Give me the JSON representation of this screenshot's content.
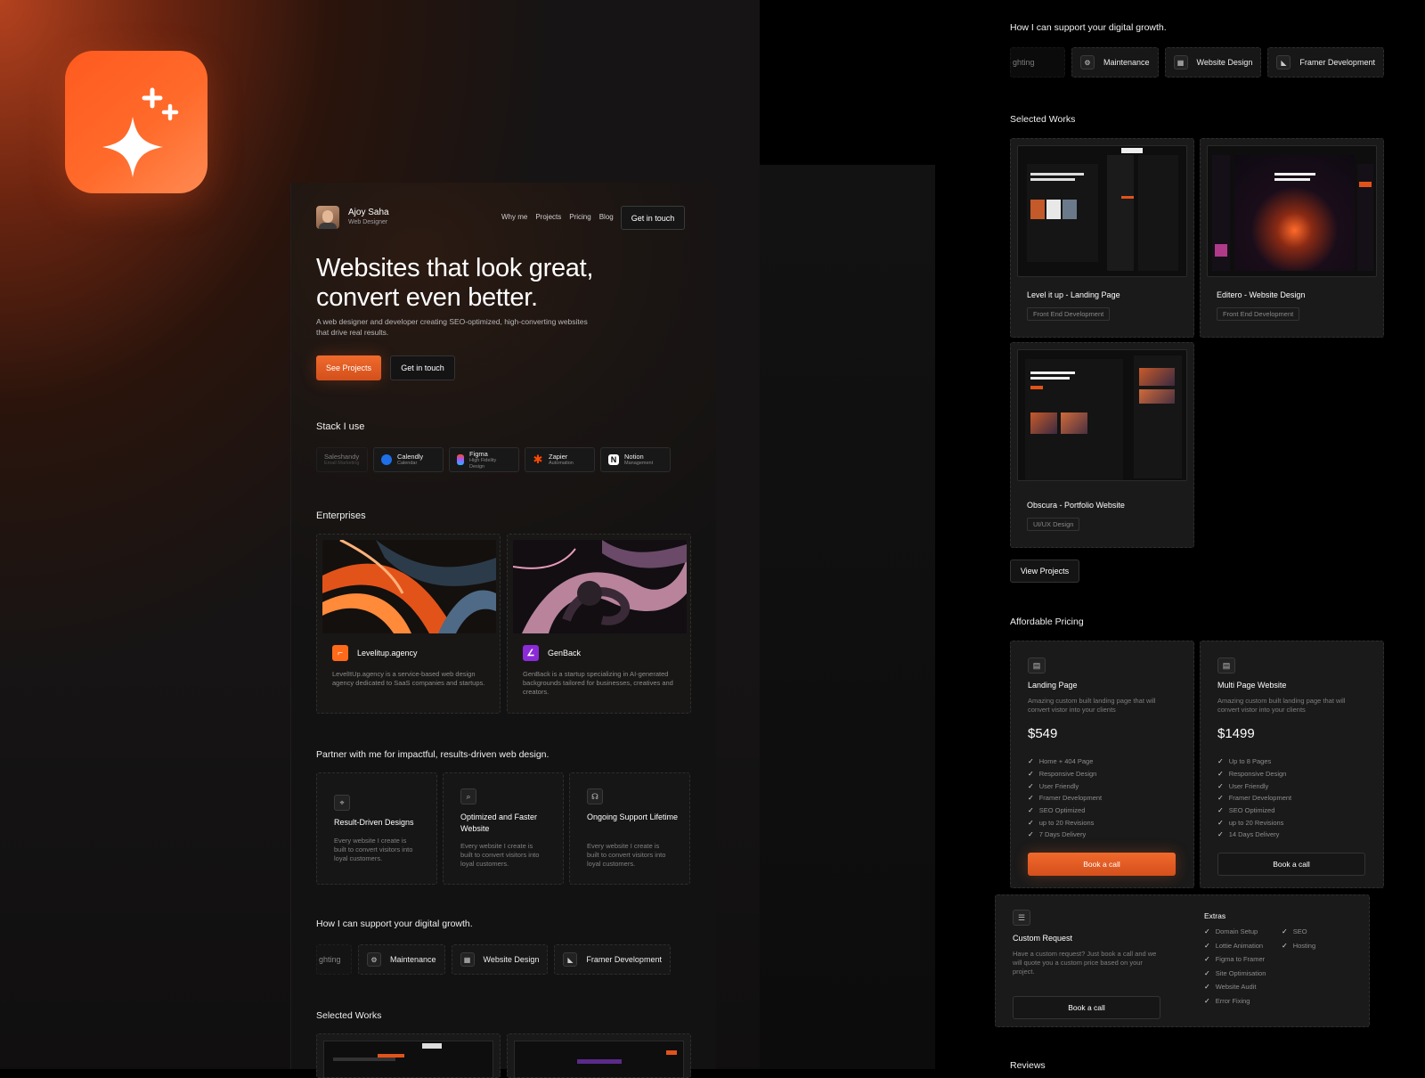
{
  "brand": {
    "icon_name": "sparkles-icon",
    "accent": "#ff5a1f"
  },
  "nav": {
    "name": "Ajoy Saha",
    "role": "Web Designer",
    "links": [
      "Why me",
      "Projects",
      "Pricing",
      "Blog"
    ],
    "cta": "Get in touch"
  },
  "hero": {
    "title_line1": "Websites that look great,",
    "title_line2": "convert even better.",
    "subtitle_line1": "A web designer and developer creating SEO-optimized, high-converting websites",
    "subtitle_line2": "that drive real results.",
    "primary": "See Projects",
    "secondary": "Get in touch"
  },
  "stack": {
    "title": "Stack I use",
    "items": [
      {
        "name": "Saleshandy",
        "sub": "Email Marketing"
      },
      {
        "name": "Calendly",
        "sub": "Calendar"
      },
      {
        "name": "Figma",
        "sub": "High Fidelity Design"
      },
      {
        "name": "Zapier",
        "sub": "Automation"
      },
      {
        "name": "Notion",
        "sub": "Management"
      }
    ]
  },
  "enterprises": {
    "title": "Enterprises",
    "items": [
      {
        "name": "Levelitup.agency",
        "desc": "LevelItUp.agency is a service-based web design agency dedicated to SaaS companies and startups."
      },
      {
        "name": "GenBack",
        "desc": "GenBack is a startup specializing in AI-generated backgrounds tailored for businesses, creatives and creators."
      }
    ]
  },
  "partner": {
    "title": "Partner with me for impactful, results-driven web design.",
    "items": [
      {
        "title": "Result-Driven Designs",
        "desc": "Every website I create is built to convert visitors into loyal customers."
      },
      {
        "title": "Optimized and Faster Website",
        "desc": "Every website I create is built to convert visitors into loyal customers."
      },
      {
        "title": "Ongoing Support Lifetime",
        "desc": "Every website I create is built to convert visitors into loyal customers."
      }
    ]
  },
  "services": {
    "title": "How I can support your digital growth.",
    "items": [
      "ghting",
      "Maintenance",
      "Website Design",
      "Framer Development"
    ]
  },
  "works": {
    "title": "Selected Works",
    "items": [
      {
        "name": "Level it up - Landing Page",
        "tag": "Front End Development"
      },
      {
        "name": "Editero - Website Design",
        "tag": "Front End Development"
      },
      {
        "name": "Obscura - Portfolio Website",
        "tag": "UI/UX Design"
      }
    ],
    "button": "View Projects"
  },
  "pricing": {
    "title": "Affordable Pricing",
    "plans": [
      {
        "name": "Landing Page",
        "desc": "Amazing custom built landing page that will convert vistor into your clients",
        "price": "$549",
        "features": [
          "Home + 404 Page",
          "Responsive Design",
          "User Friendly",
          "Framer Development",
          "SEO Optimized",
          "up to 20 Revisions",
          "7 Days Delivery"
        ],
        "button": "Book a call"
      },
      {
        "name": "Multi Page Website",
        "desc": "Amazing custom built landing page that will convert vistor into your clients",
        "price": "$1499",
        "features": [
          "Up to 8 Pages",
          "Responsive Design",
          "User Friendly",
          "Framer Development",
          "SEO Optimized",
          "up to 20 Revisions",
          "14 Days Delivery"
        ],
        "button": "Book a call"
      }
    ],
    "custom": {
      "name": "Custom Request",
      "desc": "Have a custom request? Just book a call and we will quote you a custom price based on your project.",
      "button": "Book a call",
      "extras_title": "Extras",
      "extras_col1": [
        "Domain Setup",
        "Lottie Animation",
        "Figma to Framer",
        "Site Optimisation",
        "Website Audit",
        "Error Fixing"
      ],
      "extras_col2": [
        "SEO",
        "Hosting"
      ]
    }
  },
  "reviews": {
    "title": "Reviews"
  }
}
